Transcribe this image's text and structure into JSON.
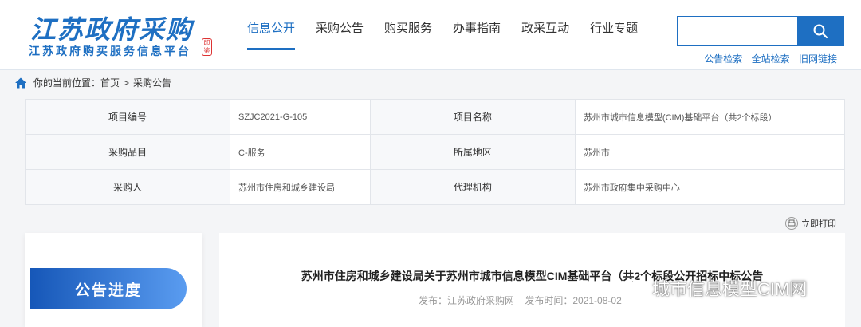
{
  "header": {
    "logo_calligraphy": "江苏政府采购",
    "logo_subtitle": "江苏政府购买服务信息平台",
    "logo_seal": "印鉴",
    "nav": [
      {
        "label": "信息公开",
        "active": true
      },
      {
        "label": "采购公告",
        "active": false
      },
      {
        "label": "购买服务",
        "active": false
      },
      {
        "label": "办事指南",
        "active": false
      },
      {
        "label": "政采互动",
        "active": false
      },
      {
        "label": "行业专题",
        "active": false
      }
    ],
    "search": {
      "value": "",
      "placeholder": ""
    },
    "quick_links": [
      "公告检索",
      "全站检索",
      "旧网链接"
    ]
  },
  "breadcrumb": {
    "prefix": "你的当前位置：",
    "home": "首页",
    "separator": ">",
    "current": "采购公告"
  },
  "info_table": [
    {
      "label1": "项目编号",
      "value1": "SZJC2021-G-105",
      "label2": "项目名称",
      "value2": "苏州市城市信息模型(CIM)基础平台（共2个标段）"
    },
    {
      "label1": "采购品目",
      "value1": "C-服务",
      "label2": "所属地区",
      "value2": "苏州市"
    },
    {
      "label1": "采购人",
      "value1": "苏州市住房和城乡建设局",
      "label2": "代理机构",
      "value2": "苏州市政府集中采购中心"
    }
  ],
  "print_label": "立即打印",
  "sidebar": {
    "progress_label": "公告进度"
  },
  "article": {
    "title": "苏州市住房和城乡建设局关于苏州市城市信息模型CIM基础平台（共2个标段公开招标中标公告",
    "publisher": "发布：江苏政府采购网",
    "publish_time": "发布时间：2021-08-02"
  },
  "watermark": "城市信息模型CIM网",
  "colors": {
    "brand": "#1e6fc2",
    "pill_start": "#1657b8",
    "pill_end": "#5a9cf0"
  }
}
